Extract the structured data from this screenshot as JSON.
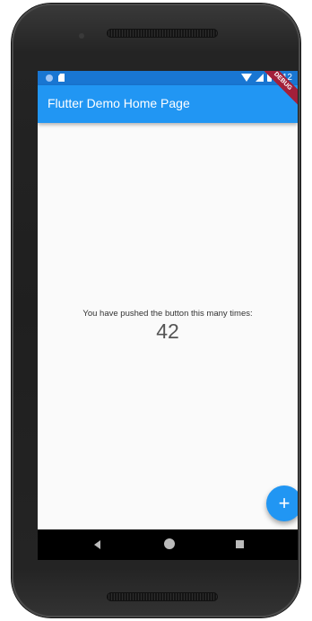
{
  "status_bar": {
    "time": "6:12",
    "color": "#1976d2",
    "icons": [
      "notification-dot-icon",
      "sd-card-icon",
      "wifi-icon",
      "signal-icon",
      "battery-icon"
    ]
  },
  "app_bar": {
    "title": "Flutter Demo Home Page",
    "color": "#2196f3"
  },
  "debug_banner": {
    "label": "DEBUG"
  },
  "body": {
    "message": "You have pushed the button this many times:",
    "counter": "42"
  },
  "fab": {
    "label": "+",
    "icon": "add-icon",
    "color": "#2196f3"
  },
  "nav_bar": {
    "icons": [
      "back-icon",
      "home-icon",
      "recents-icon"
    ]
  }
}
